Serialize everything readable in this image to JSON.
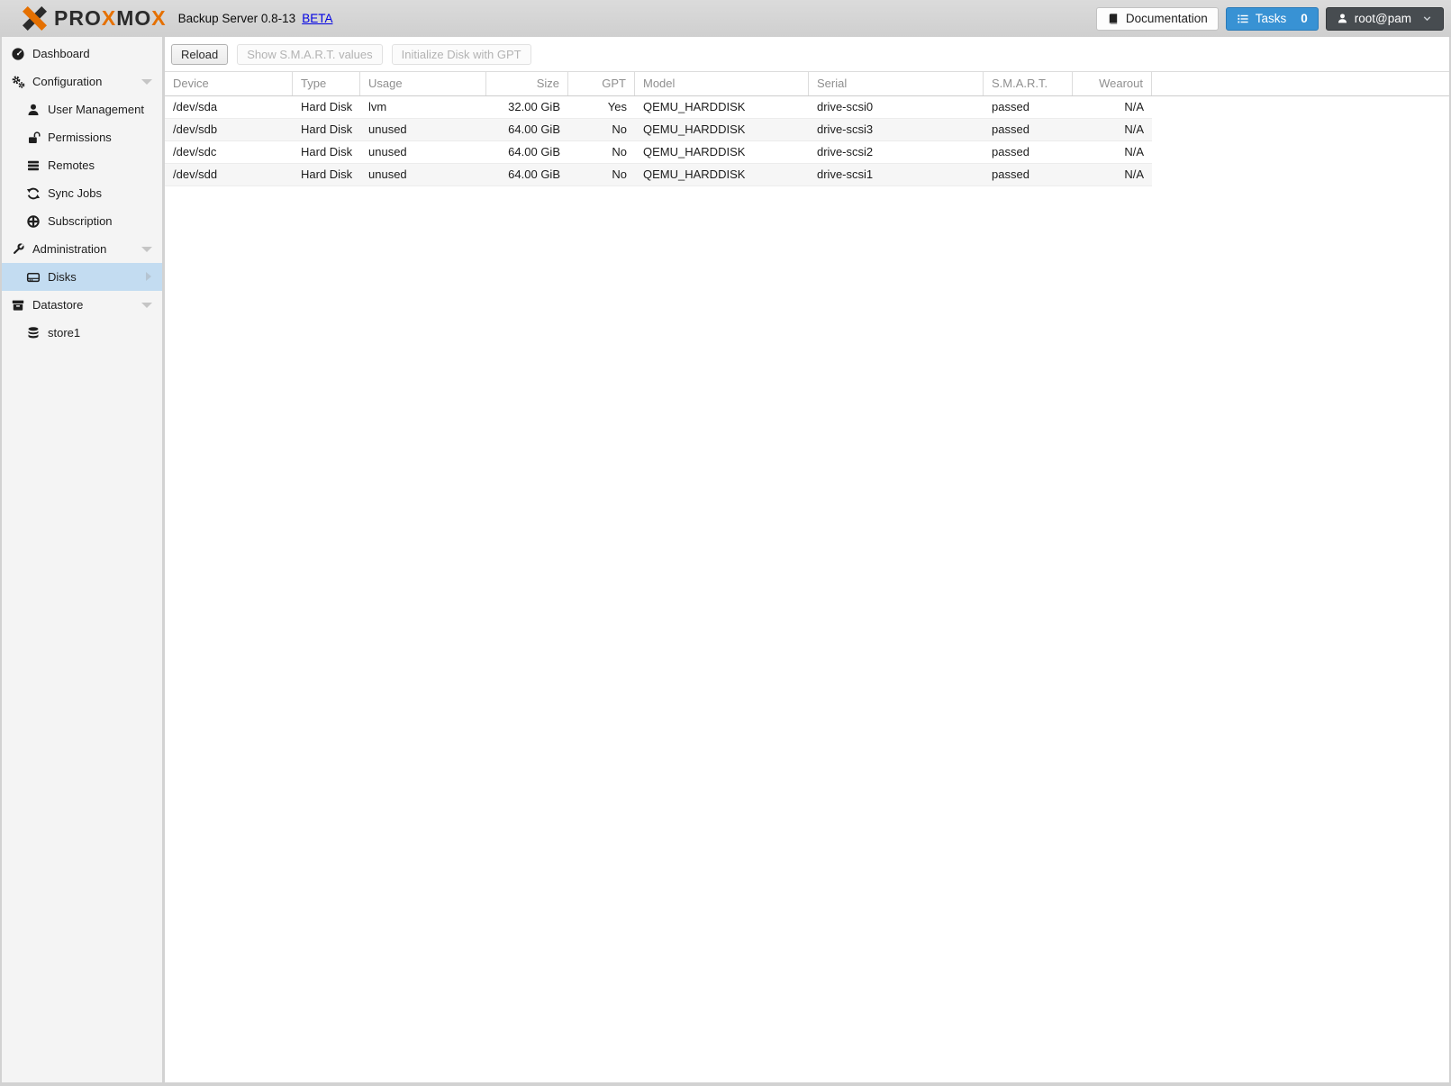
{
  "header": {
    "wordmark": "PROXMOX",
    "title": "Backup Server 0.8-13",
    "beta_label": "BETA",
    "documentation_label": "Documentation",
    "tasks_label": "Tasks",
    "tasks_count": "0",
    "user_label": "root@pam"
  },
  "colors": {
    "brand_orange": "#e57000",
    "accent_blue": "#3892d4",
    "selection_blue": "#c3dcf1"
  },
  "sidebar": {
    "items": [
      {
        "label": "Dashboard",
        "icon": "dashboard-icon",
        "level": 0
      },
      {
        "label": "Configuration",
        "icon": "gears-icon",
        "level": 0,
        "expandable": true
      },
      {
        "label": "User Management",
        "icon": "user-icon",
        "level": 1
      },
      {
        "label": "Permissions",
        "icon": "unlock-icon",
        "level": 1
      },
      {
        "label": "Remotes",
        "icon": "server-icon",
        "level": 1
      },
      {
        "label": "Sync Jobs",
        "icon": "sync-icon",
        "level": 1
      },
      {
        "label": "Subscription",
        "icon": "lifering-icon",
        "level": 1
      },
      {
        "label": "Administration",
        "icon": "wrench-icon",
        "level": 0,
        "expandable": true
      },
      {
        "label": "Disks",
        "icon": "hdd-icon",
        "level": 1,
        "selected": true,
        "arrow_right": true
      },
      {
        "label": "Datastore",
        "icon": "archive-icon",
        "level": 0,
        "expandable": true
      },
      {
        "label": "store1",
        "icon": "database-icon",
        "level": 1
      }
    ]
  },
  "toolbar": {
    "reload_label": "Reload",
    "smart_label": "Show S.M.A.R.T. values",
    "gpt_label": "Initialize Disk with GPT"
  },
  "table": {
    "columns": [
      "Device",
      "Type",
      "Usage",
      "Size",
      "GPT",
      "Model",
      "Serial",
      "S.M.A.R.T.",
      "Wearout"
    ],
    "rows": [
      [
        "/dev/sda",
        "Hard Disk",
        "lvm",
        "32.00 GiB",
        "Yes",
        "QEMU_HARDDISK",
        "drive-scsi0",
        "passed",
        "N/A"
      ],
      [
        "/dev/sdb",
        "Hard Disk",
        "unused",
        "64.00 GiB",
        "No",
        "QEMU_HARDDISK",
        "drive-scsi3",
        "passed",
        "N/A"
      ],
      [
        "/dev/sdc",
        "Hard Disk",
        "unused",
        "64.00 GiB",
        "No",
        "QEMU_HARDDISK",
        "drive-scsi2",
        "passed",
        "N/A"
      ],
      [
        "/dev/sdd",
        "Hard Disk",
        "unused",
        "64.00 GiB",
        "No",
        "QEMU_HARDDISK",
        "drive-scsi1",
        "passed",
        "N/A"
      ]
    ]
  }
}
